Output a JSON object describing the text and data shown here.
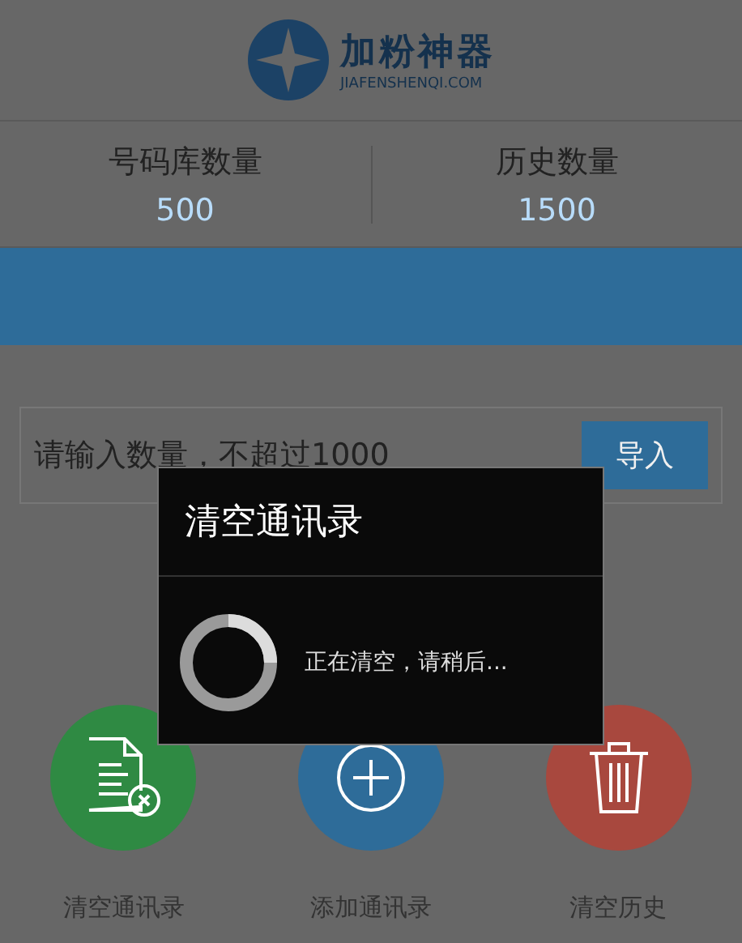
{
  "header": {
    "logo_title": "加粉神器",
    "logo_subtitle": "JIAFENSHENQI.COM"
  },
  "stats": [
    {
      "label": "号码库数量",
      "value": "500"
    },
    {
      "label": "历史数量",
      "value": "1500"
    }
  ],
  "quantity_input": {
    "placeholder": "请输入数量，不超过1000"
  },
  "import_button": "导入",
  "actions": [
    {
      "kind": "clear-contacts",
      "label": "清空通讯录",
      "color": "#2f8a43"
    },
    {
      "kind": "add-contacts",
      "label": "添加通讯录",
      "color": "#2e6c99"
    },
    {
      "kind": "clear-history",
      "label": "清空历史",
      "color": "#a8483e"
    }
  ],
  "dialog": {
    "title": "清空通讯录",
    "message": "正在清空，请稍后..."
  }
}
